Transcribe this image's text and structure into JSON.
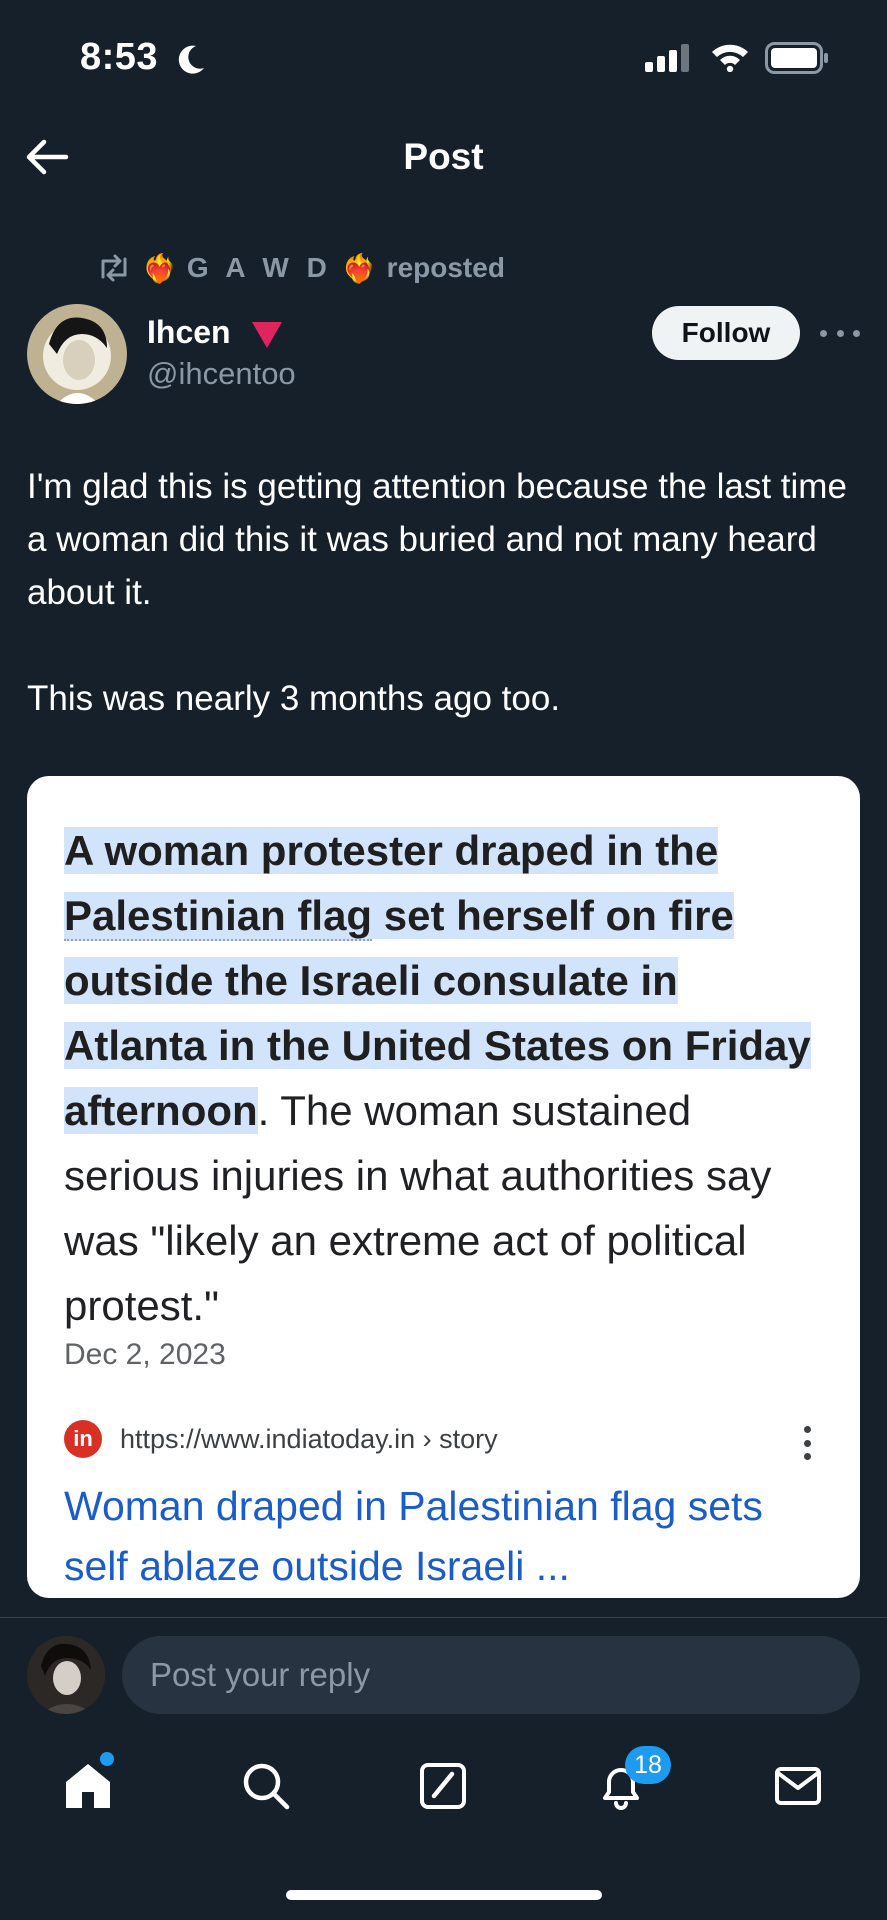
{
  "status_bar": {
    "time": "8:53"
  },
  "header": {
    "title": "Post"
  },
  "repost": {
    "name": "G A W D",
    "action": "reposted",
    "emoji": "❤️‍🔥"
  },
  "author": {
    "name": "Ihcen",
    "handle": "@ihcentoo",
    "follow_label": "Follow"
  },
  "post": {
    "paragraphs": [
      "I'm glad this is getting attention because the last time a woman did this it was buried and not many heard about it.",
      "This was nearly 3 months ago too."
    ]
  },
  "card": {
    "highlight_part1": "A woman protester draped in the ",
    "highlight_underlined": "Palestinian flag",
    "highlight_part2": " set herself on fire outside the Israeli consulate in Atlanta in the United States on Friday afternoon",
    "rest_text": ". The woman sustained serious injuries in what authorities say was \"likely an extreme act of political protest.\"",
    "date": "Dec 2, 2023",
    "source_logo": "in",
    "source_url": "https://www.indiatoday.in › story",
    "link_title": "Woman draped in Palestinian flag sets self ablaze outside Israeli ..."
  },
  "reply": {
    "placeholder": "Post your reply"
  },
  "nav": {
    "notifications_badge": "18",
    "items": [
      "home-icon",
      "search-icon",
      "compose-icon",
      "bell-icon",
      "mail-icon"
    ]
  },
  "colors": {
    "background": "#15202b",
    "accent": "#1d9bf0",
    "muted": "#8b98a5",
    "badge_red": "#e0245e"
  }
}
